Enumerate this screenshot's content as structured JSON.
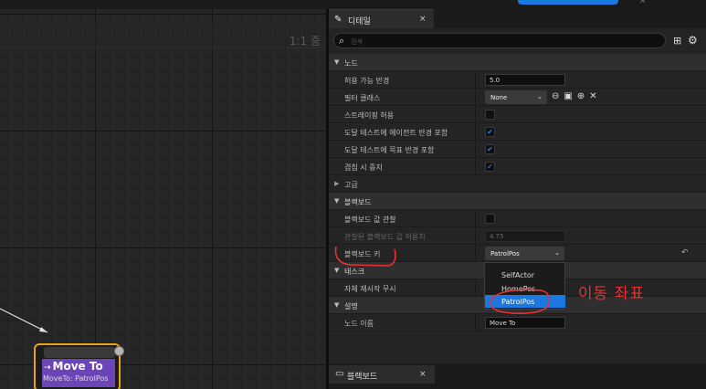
{
  "top_tab": {
    "close": "×"
  },
  "graph": {
    "zoom": "1:1 줌",
    "node": {
      "title": "Move To",
      "subtitle": "MoveTo: PatrolPos"
    }
  },
  "details": {
    "tab": {
      "icon": "pencil-icon",
      "label": "디테일",
      "close": "×"
    },
    "search": {
      "placeholder": "검색"
    },
    "categories": {
      "node": "노드",
      "advanced": "고급",
      "blackboard": "블랙보드",
      "task": "태스크",
      "description": "설명"
    },
    "rows": {
      "acceptable_radius": {
        "label": "허용 가능 반경",
        "value": "5.0"
      },
      "filter_class": {
        "label": "필터 클래스",
        "value": "None"
      },
      "allow_strafe": {
        "label": "스트레이핑 허용",
        "checked": false
      },
      "reach_test_agent_radius": {
        "label": "도달 테스트에 에이전트 반경 포함",
        "checked": true
      },
      "reach_test_goal_radius": {
        "label": "도달 테스트에 목표 반경 포함",
        "checked": true
      },
      "stop_on_overlap": {
        "label": "겹침 시 중지",
        "checked": true
      },
      "observe_blackboard_value": {
        "label": "블랙보드 값 관찰",
        "checked": false
      },
      "observed_tolerance": {
        "label": "관찰된 블랙보드 값 허용치",
        "value": "4.75"
      },
      "blackboard_key": {
        "label": "블랙보드 키",
        "value": "PatrolPos"
      },
      "ignore_restart_self": {
        "label": "자체 재시작 무시",
        "checked": false
      },
      "node_name": {
        "label": "노드 이름",
        "value": "Move To"
      }
    },
    "dropdown": {
      "options": [
        "SelfActor",
        "HomePos",
        "PatrolPos"
      ],
      "selected": "PatrolPos"
    }
  },
  "annotation": {
    "text": "이동 좌표",
    "color": "#e53333"
  },
  "bottom_tab": {
    "icon": "blackboard-icon",
    "label": "블랙보드",
    "close": "×"
  },
  "colors": {
    "accent": "#1a78e0",
    "node_body": "#6b44b8",
    "node_border": "#e7a31b",
    "checkbox": "#2a80ff"
  }
}
